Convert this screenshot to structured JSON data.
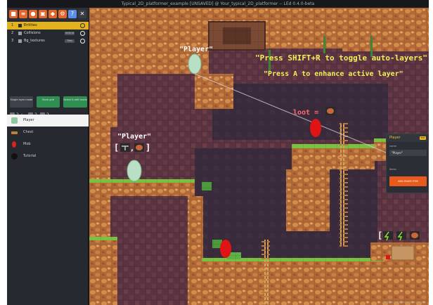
{
  "window": {
    "title": "Typical_2D_platformer_example [UNSAVED] @ Your_typical_2D_platformer -- LEd 0.4.0-beta"
  },
  "toolbar": {
    "tools": [
      {
        "icon": "project-icon",
        "color": "#e2652a"
      },
      {
        "icon": "layers-icon",
        "color": "#e2652a"
      },
      {
        "icon": "entities-icon",
        "color": "#e2652a"
      },
      {
        "icon": "enums-icon",
        "color": "#e2652a"
      },
      {
        "icon": "tilesets-icon",
        "color": "#e2652a"
      },
      {
        "icon": "settings-icon",
        "color": "#e2652a"
      },
      {
        "icon": "help-icon",
        "color": "#5b8fe5"
      },
      {
        "icon": "close-icon",
        "color": "#3a3d43"
      }
    ]
  },
  "layers": [
    {
      "num": "1",
      "name": "Entities",
      "tag": "",
      "active": true
    },
    {
      "num": "2",
      "name": "Collisions",
      "tag": "IntGrid",
      "active": false
    },
    {
      "num": "3",
      "name": "Bg_textures",
      "tag": "Tiles",
      "active": false
    }
  ],
  "mode_buttons": [
    {
      "label": "Single layer mode",
      "active": false
    },
    {
      "label": "Show grid",
      "active": true
    },
    {
      "label": "Select & edit mode",
      "active": true
    }
  ],
  "mini_controls": [
    "2",
    "8",
    "2",
    "2"
  ],
  "entities": [
    {
      "name": "Player",
      "color": "#8fc7a0",
      "active": true
    },
    {
      "name": "Chest",
      "color": "#c07f3a",
      "active": false
    },
    {
      "name": "Mob",
      "color": "#d9251e",
      "active": false
    },
    {
      "name": "Tutorial",
      "color": "#111111",
      "active": false
    }
  ],
  "canvas": {
    "tutorial_line1": "\"Press SHIFT+R to toggle auto-layers\"",
    "tutorial_line2": "\"Press A to enhance active layer\"",
    "player_label_top": "\"Player\"",
    "player_label_left": "\"Player\"",
    "loot_label": "loot =",
    "mob_color": "#e01414",
    "player_color": "#b9e0c4",
    "tutorial_color": "#f4ef5c"
  },
  "properties": {
    "header": "Player",
    "badge": "Edit",
    "field_label": "name",
    "field_value": "\"Player\"",
    "items_label": "Items",
    "add_button": "ADD ENUM ITEM"
  },
  "status": "Entities > 0 items > 0 | x=0 y=0"
}
